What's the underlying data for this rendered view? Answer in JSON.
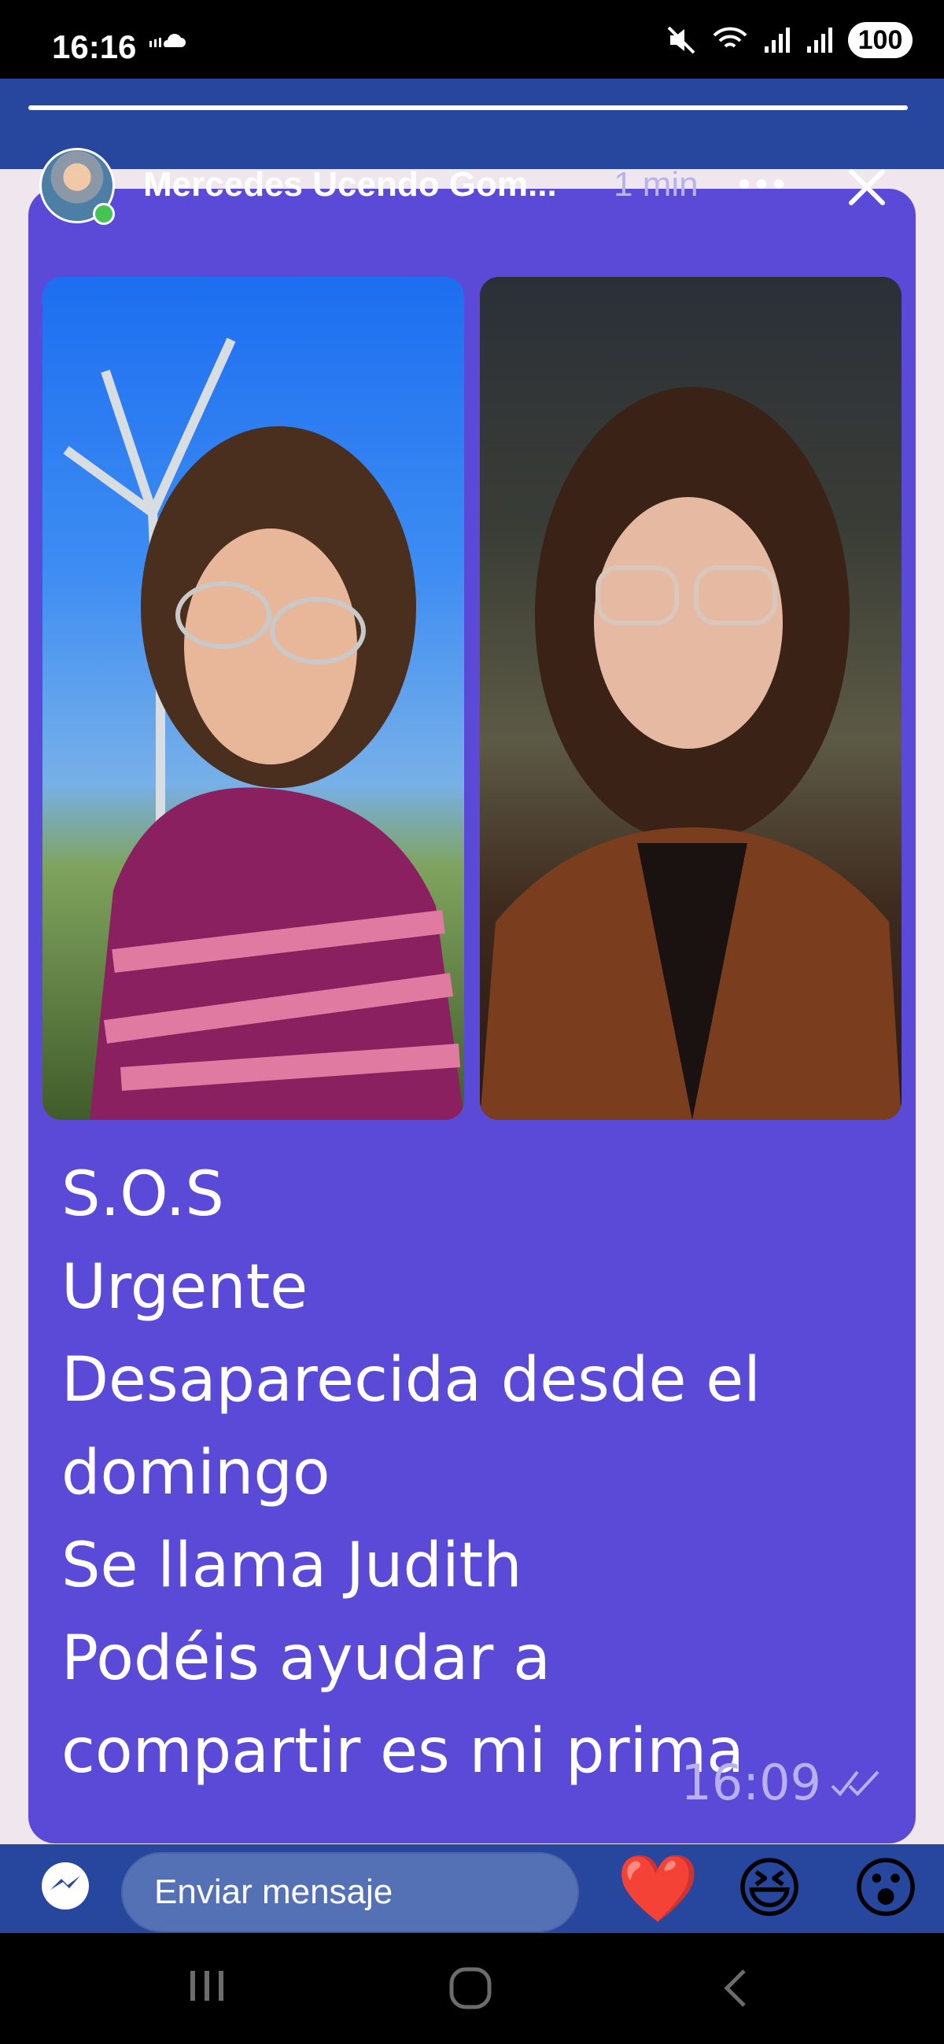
{
  "status_bar": {
    "time": "16:16",
    "battery": "100"
  },
  "story": {
    "poster_name": "Mercedes Ucendo Gom...",
    "post_time": "1 min"
  },
  "message": {
    "lines": [
      "S.O.S",
      "Urgente",
      "Desaparecida desde el",
      "domingo",
      "Se llama Judith",
      "Podéis ayudar a",
      "compartir es mi prima"
    ],
    "time": "16:09"
  },
  "reply": {
    "placeholder": "Enviar mensaje",
    "reactions": [
      "❤️",
      "😆",
      "😮"
    ]
  },
  "icons": {
    "messenger": "messenger-icon",
    "more": "more-options-icon",
    "close": "close-icon"
  },
  "colors": {
    "card": "#5b49d8",
    "story_bar": "#27479e"
  }
}
